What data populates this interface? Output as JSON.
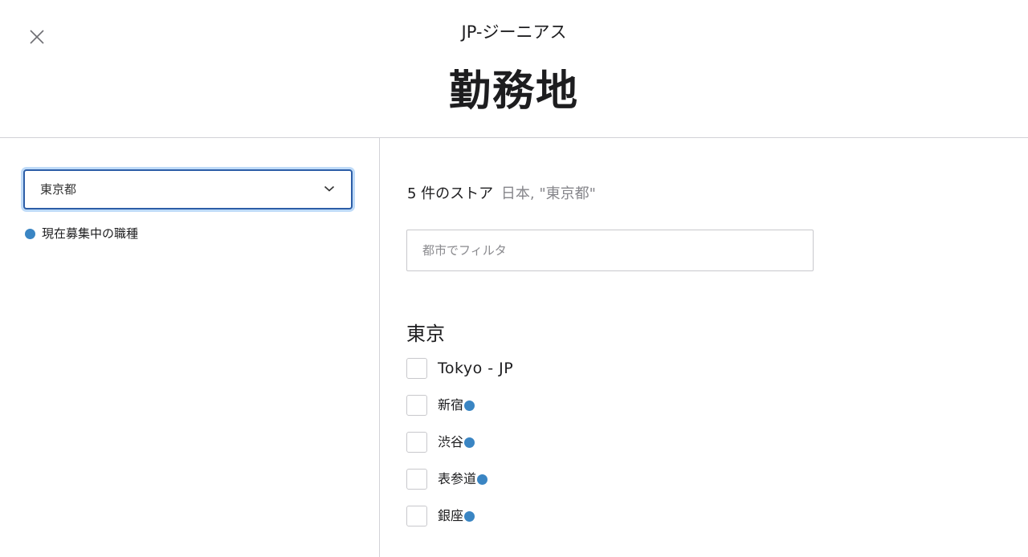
{
  "header": {
    "close_icon": "close-icon",
    "subtitle": "JP-ジーニアス",
    "title": "勤務地"
  },
  "sidebar": {
    "region_select": {
      "value": "東京都",
      "icon": "chevron-down-icon"
    },
    "legend": {
      "label": "現在募集中の職種",
      "dot_color": "#3a85c3"
    }
  },
  "main": {
    "result_count": "5 件のストア",
    "result_query": "日本, \"東京都\"",
    "filter": {
      "placeholder": "都市でフィルタ",
      "value": ""
    },
    "city": "東京",
    "stores": [
      {
        "name": "Tokyo - JP",
        "hiring": false,
        "checked": false
      },
      {
        "name": "新宿",
        "hiring": true,
        "checked": false
      },
      {
        "name": "渋谷",
        "hiring": true,
        "checked": false
      },
      {
        "name": "表参道",
        "hiring": true,
        "checked": false
      },
      {
        "name": "銀座",
        "hiring": true,
        "checked": false
      }
    ]
  },
  "colors": {
    "accent": "#2d5ea7",
    "hiring_dot": "#3a85c3",
    "text": "#1d1d1f",
    "muted": "#86868b",
    "border": "#d2d2d7"
  }
}
